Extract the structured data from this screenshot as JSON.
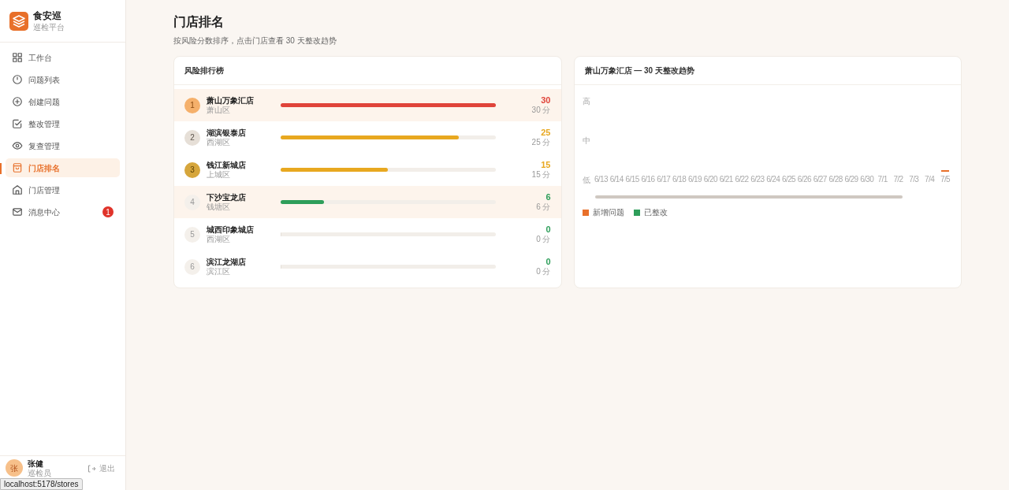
{
  "sidebar": {
    "brand": {
      "name": "食安巡",
      "subtitle": "巡检平台"
    },
    "items": [
      {
        "label": "工作台",
        "selected": false
      },
      {
        "label": "问题列表",
        "selected": false
      },
      {
        "label": "创建问题",
        "selected": false
      },
      {
        "label": "整改管理",
        "selected": false
      },
      {
        "label": "复查管理",
        "selected": false
      },
      {
        "label": "门店排名",
        "selected": true
      },
      {
        "label": "门店管理",
        "selected": false
      },
      {
        "label": "消息中心",
        "selected": false,
        "badge": "1"
      }
    ],
    "user": {
      "avatar": "张",
      "name": "张健",
      "role": "巡检员",
      "logout": "退出"
    }
  },
  "page": {
    "title": "门店排名",
    "subtitle": "按风险分数排序，点击门店查看 30 天整改趋势"
  },
  "ranking": {
    "title": "风险排行榜",
    "rows": [
      {
        "rank": "1",
        "name": "萧山万象汇店",
        "district": "萧山区",
        "level": 1,
        "score": "30",
        "score_text": "30 分",
        "color": "#e0443a",
        "highlighted": true
      },
      {
        "rank": "2",
        "name": "湖滨银泰店",
        "district": "西湖区",
        "level": 0.83,
        "score": "25",
        "score_text": "25 分",
        "color": "#e8a820",
        "highlighted": false
      },
      {
        "rank": "3",
        "name": "钱江新城店",
        "district": "上城区",
        "level": 0.5,
        "score": "15",
        "score_text": "15 分",
        "color": "#e8a820",
        "highlighted": false
      },
      {
        "rank": "4",
        "name": "下沙宝龙店",
        "district": "钱塘区",
        "level": 0.2,
        "score": "6",
        "score_text": "6 分",
        "color": "#2e9e5a",
        "highlighted": true
      },
      {
        "rank": "5",
        "name": "城西印象城店",
        "district": "西湖区",
        "level": 0,
        "score": "0",
        "score_text": "0 分",
        "color": "#2e9e5a",
        "highlighted": false
      },
      {
        "rank": "6",
        "name": "滨江龙湖店",
        "district": "滨江区",
        "level": 0,
        "score": "0",
        "score_text": "0 分",
        "color": "#2e9e5a",
        "highlighted": false
      }
    ]
  },
  "trend": {
    "title": "萧山万象汇店 — 30 天整改趋势",
    "y_labels": [
      "高",
      "中",
      "低"
    ],
    "x_labels": [
      "6/13",
      "6/14",
      "6/15",
      "6/16",
      "6/17",
      "6/18",
      "6/19",
      "6/20",
      "6/21",
      "6/22",
      "6/23",
      "6/24",
      "6/25",
      "6/26",
      "6/27",
      "6/28",
      "6/29",
      "6/30",
      "7/1",
      "7/2",
      "7/3",
      "7/4",
      "7/5"
    ],
    "legend": [
      {
        "label": "新增问题",
        "color": "#e8702a"
      },
      {
        "label": "已整改",
        "color": "#2e9e5a"
      }
    ]
  },
  "status_bar": {
    "url": "localhost:5178/stores"
  }
}
